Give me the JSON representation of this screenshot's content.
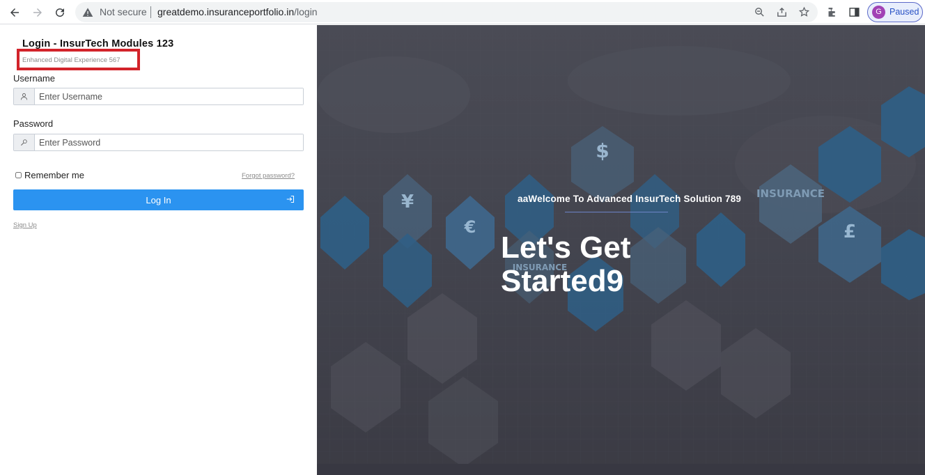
{
  "browser": {
    "security_text": "Not secure",
    "url_domain": "greatdemo.insuranceportfolio.in",
    "url_path": "/login",
    "profile_initial": "G",
    "profile_status": "Paused"
  },
  "login": {
    "title": "Login - InsurTech Modules 123",
    "subtitle": "Enhanced Digital Experience 567",
    "username_label": "Username",
    "username_placeholder": "Enter Username",
    "password_label": "Password",
    "password_placeholder": "Enter Password",
    "remember_label": "Remember me",
    "forgot_label": "Forgot password?",
    "login_button": "Log In",
    "signup_label": "Sign Up"
  },
  "hero": {
    "welcome": "aaWelcome To Advanced InsurTech Solution 789",
    "heading": "Let's Get Started9",
    "badge_text": "INSURANCE",
    "badge_text_2": "INSURANCE"
  },
  "colors": {
    "primary_button": "#2b93f0",
    "highlight_border": "#d2232a",
    "hero_bg": "#45464f"
  }
}
